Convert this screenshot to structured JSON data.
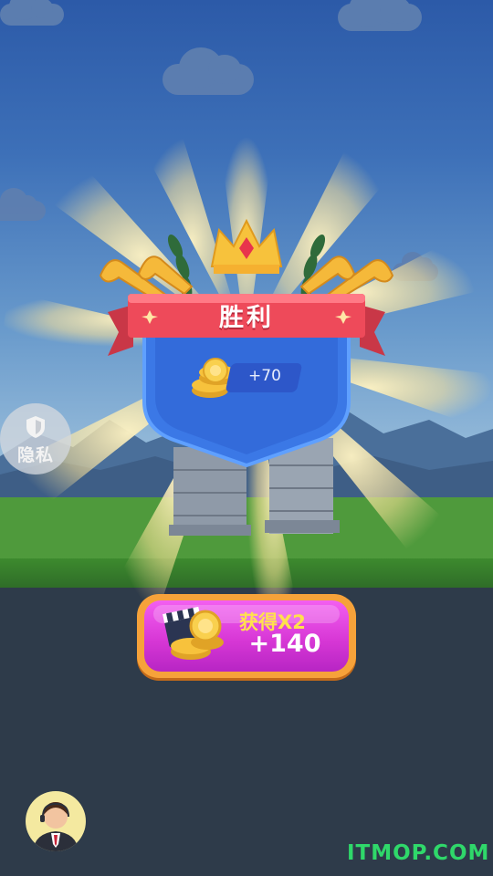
{
  "screen": {
    "title": "胜利",
    "reward": {
      "amount_text": "+70",
      "icon": "coin-stack-icon"
    }
  },
  "privacy_button": {
    "label": "隐私",
    "icon": "shield-icon"
  },
  "double_reward_button": {
    "label": "获得X2",
    "amount_text": "+140",
    "icons": [
      "video-clapper-icon",
      "coin-stack-icon"
    ]
  },
  "support_avatar": {
    "icon": "customer-service-agent-icon"
  },
  "watermark": {
    "text": "ITMOP.COM"
  },
  "colors": {
    "ribbon": "#ee4a5a",
    "shield": "#3b78e6",
    "button_pink": "#d838d6",
    "button_border": "#f6a23a",
    "gold": "#f5c23a",
    "watermark": "#2fd86a"
  }
}
